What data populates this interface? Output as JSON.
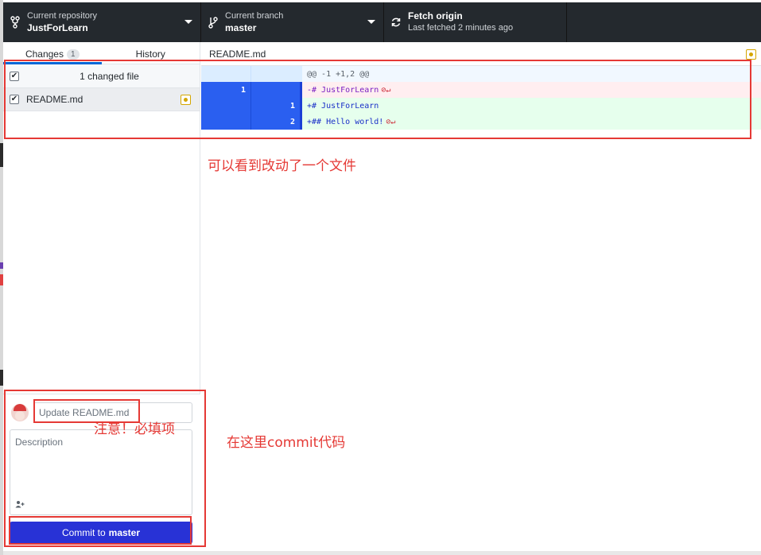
{
  "toolbar": {
    "repository": {
      "label": "Current repository",
      "value": "JustForLearn"
    },
    "branch": {
      "label": "Current branch",
      "value": "master"
    },
    "fetch": {
      "label": "Fetch origin",
      "status": "Last fetched 2 minutes ago"
    }
  },
  "sidebar": {
    "tabs": [
      {
        "label": "Changes",
        "count": "1"
      },
      {
        "label": "History"
      }
    ],
    "changed_header": "1 changed file",
    "files": [
      {
        "name": "README.md"
      }
    ]
  },
  "diff": {
    "file": "README.md",
    "hunk": "@@ -1 +1,2 @@",
    "lines": [
      {
        "type": "del",
        "old": "1",
        "new": "",
        "text": "-# JustForLearn"
      },
      {
        "type": "add",
        "old": "",
        "new": "1",
        "text": "+# JustForLearn"
      },
      {
        "type": "add",
        "old": "",
        "new": "2",
        "text": "+## Hello world!"
      }
    ],
    "no_newline_glyph": "⊘↵"
  },
  "commit": {
    "summary_placeholder": "Update README.md",
    "description_placeholder": "Description",
    "button_prefix": "Commit to",
    "button_branch": "master"
  },
  "annotations": {
    "diff_note": "可以看到改动了一个文件",
    "required_note": "注意！必填项",
    "commit_note": "在这里commit代码"
  },
  "colors": {
    "toolbar_bg": "#24292e",
    "accent_blue": "#2832d6",
    "annotation_red": "#e53935",
    "modified_badge": "#d4a600"
  }
}
